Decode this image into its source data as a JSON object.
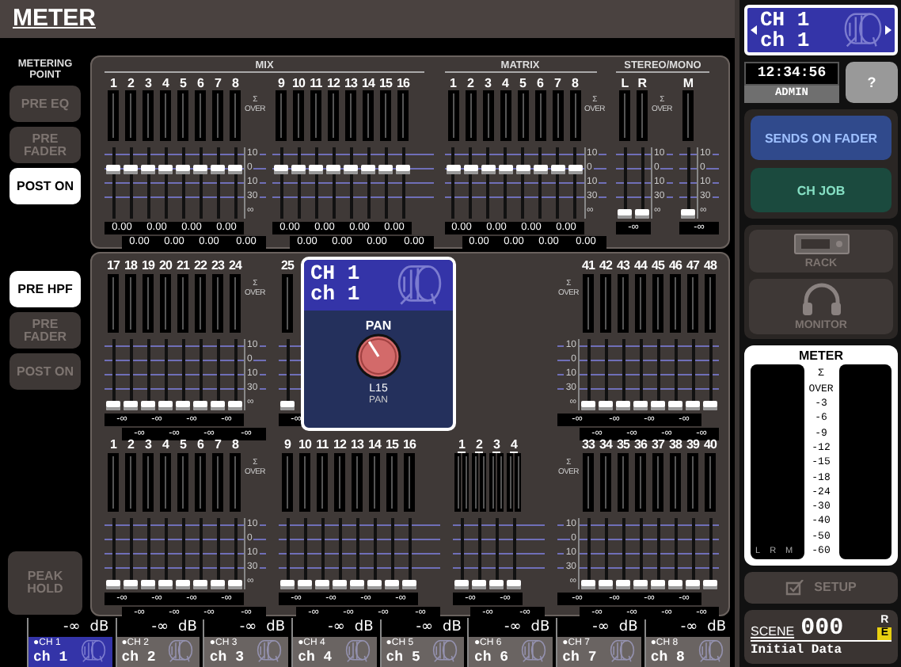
{
  "header": {
    "title": "METER"
  },
  "metering_point": {
    "label": "METERING POINT",
    "output_buttons": [
      {
        "label": "PRE EQ",
        "selected": false
      },
      {
        "label": "PRE FADER",
        "selected": false
      },
      {
        "label": "POST ON",
        "selected": true
      }
    ],
    "input_buttons": [
      {
        "label": "PRE HPF",
        "selected": true
      },
      {
        "label": "PRE FADER",
        "selected": false
      },
      {
        "label": "POST ON",
        "selected": false
      }
    ],
    "peak_hold": {
      "label": "PEAK HOLD",
      "on": false
    }
  },
  "output_panel": {
    "groups": [
      {
        "title": "MIX",
        "blocks": [
          {
            "kind": "mono8",
            "labels": [
              "1",
              "2",
              "3",
              "4",
              "5",
              "6",
              "7",
              "8"
            ],
            "level": 0.72,
            "values": [
              "0.00",
              "0.00",
              "0.00",
              "0.00",
              "0.00",
              "0.00",
              "0.00",
              "0.00"
            ],
            "over": "Σ OVER",
            "scale": [
              "10",
              "0",
              "10",
              "30",
              "∞"
            ],
            "scale_left": false
          },
          {
            "kind": "mono8",
            "labels": [
              "9",
              "10",
              "11",
              "12",
              "13",
              "14",
              "15",
              "16"
            ],
            "level": 0.72,
            "values": [
              "0.00",
              "0.00",
              "0.00",
              "0.00",
              "0.00",
              "0.00",
              "0.00",
              "0.00"
            ]
          }
        ]
      },
      {
        "title": "MATRIX",
        "blocks": [
          {
            "kind": "mono8",
            "labels": [
              "1",
              "2",
              "3",
              "4",
              "5",
              "6",
              "7",
              "8"
            ],
            "level": 0.72,
            "values": [
              "0.00",
              "0.00",
              "0.00",
              "0.00",
              "0.00",
              "0.00",
              "0.00",
              "0.00"
            ],
            "over": "Σ OVER",
            "scale": [
              "10",
              "0",
              "10",
              "30",
              "∞"
            ],
            "scale_left": false
          }
        ]
      },
      {
        "title": "STEREO/MONO",
        "blocks": [
          {
            "kind": "pair",
            "labels": [
              "L",
              "R"
            ],
            "level": 0,
            "values": [
              "-∞"
            ],
            "over": "Σ OVER",
            "scale": [
              "10",
              "0",
              "10",
              "30",
              "∞"
            ],
            "scale_left": false
          },
          {
            "kind": "single",
            "labels": [
              "M"
            ],
            "level": 0,
            "values": [
              "-∞"
            ],
            "scale": [
              "10",
              "0",
              "10",
              "30",
              "∞"
            ],
            "scale_left": false
          }
        ]
      }
    ]
  },
  "input_panel": {
    "columns": [
      {
        "top": {
          "kind": "mono8",
          "labels": [
            "17",
            "18",
            "19",
            "20",
            "21",
            "22",
            "23",
            "24"
          ],
          "level": 0,
          "values": [
            "-∞",
            "-∞",
            "-∞",
            "-∞",
            "-∞",
            "-∞",
            "-∞",
            "-∞"
          ],
          "over": "Σ OVER",
          "scale": [
            "10",
            "0",
            "10",
            "30",
            "∞"
          ],
          "scale_left": false
        },
        "bottom": {
          "kind": "mono8",
          "labels": [
            "1",
            "2",
            "3",
            "4",
            "5",
            "6",
            "7",
            "8"
          ],
          "level": 0,
          "values": [
            "-∞",
            "-∞",
            "-∞",
            "-∞",
            "-∞",
            "-∞",
            "-∞",
            "-∞"
          ],
          "over": "Σ OVER",
          "scale": [
            "10",
            "0",
            "10",
            "30",
            "∞"
          ],
          "scale_left": false
        }
      },
      {
        "top": {
          "kind": "mono8",
          "labels": [
            "25"
          ],
          "level": 0,
          "values": [
            "-∞"
          ]
        },
        "bottom": {
          "kind": "mono8",
          "labels": [
            "9",
            "10",
            "11",
            "12",
            "13",
            "14",
            "15",
            "16"
          ],
          "level": 0,
          "values": [
            "-∞",
            "-∞",
            "-∞",
            "-∞",
            "-∞",
            "-∞",
            "-∞",
            "-∞"
          ]
        }
      },
      {
        "bottom": {
          "kind": "quad",
          "labels": [
            "1",
            "2",
            "3",
            "4"
          ],
          "level": 0,
          "values": [
            "-∞",
            "-∞",
            "-∞",
            "-∞"
          ]
        }
      },
      {
        "top": {
          "kind": "mono8",
          "labels": [
            "41",
            "42",
            "43",
            "44",
            "45",
            "46",
            "47",
            "48"
          ],
          "level": 0,
          "values": [
            "-∞",
            "-∞",
            "-∞",
            "-∞",
            "-∞",
            "-∞",
            "-∞",
            "-∞"
          ],
          "over": "Σ OVER",
          "scale": [
            "10",
            "0",
            "10",
            "30",
            "∞"
          ],
          "scale_left": true
        },
        "bottom": {
          "kind": "mono8",
          "labels": [
            "33",
            "34",
            "35",
            "36",
            "37",
            "38",
            "39",
            "40"
          ],
          "level": 0,
          "values": [
            "-∞",
            "-∞",
            "-∞",
            "-∞",
            "-∞",
            "-∞",
            "-∞",
            "-∞"
          ],
          "over": "Σ OVER",
          "scale": [
            "10",
            "0",
            "10",
            "30",
            "∞"
          ],
          "scale_left": true
        }
      }
    ],
    "popup": {
      "channel": "CH 1",
      "name": "ch 1",
      "parameter": "PAN",
      "level": 0.38,
      "value": "L15",
      "value_label": "PAN"
    }
  },
  "channel_strip": [
    {
      "reading": "-∞",
      "unit": "dB",
      "number": "●CH 1",
      "name": "ch 1",
      "selected": true
    },
    {
      "reading": "-∞",
      "unit": "dB",
      "number": "●CH 2",
      "name": "ch 2",
      "selected": false
    },
    {
      "reading": "-∞",
      "unit": "dB",
      "number": "●CH 3",
      "name": "ch 3",
      "selected": false
    },
    {
      "reading": "-∞",
      "unit": "dB",
      "number": "●CH 4",
      "name": "ch 4",
      "selected": false
    },
    {
      "reading": "-∞",
      "unit": "dB",
      "number": "●CH 5",
      "name": "ch 5",
      "selected": false
    },
    {
      "reading": "-∞",
      "unit": "dB",
      "number": "●CH 6",
      "name": "ch 6",
      "selected": false
    },
    {
      "reading": "-∞",
      "unit": "dB",
      "number": "●CH 7",
      "name": "ch 7",
      "selected": false
    },
    {
      "reading": "-∞",
      "unit": "dB",
      "number": "●CH 8",
      "name": "ch 8",
      "selected": false
    }
  ],
  "sidebar": {
    "channel": {
      "number": "CH 1",
      "name": "ch 1"
    },
    "clock": "12:34:56",
    "user": "ADMIN",
    "help": "?",
    "buttons": [
      {
        "label": "SENDS ON FADER",
        "kind": "sends"
      },
      {
        "label": "CH JOB",
        "kind": "job"
      }
    ],
    "tools": [
      {
        "label": "RACK",
        "kind": "rack",
        "disabled": true
      },
      {
        "label": "MONITOR",
        "kind": "monitor",
        "disabled": true
      }
    ],
    "meter": {
      "title": "METER",
      "scale": [
        "Σ",
        "OVER",
        "-3",
        "-6",
        "-9",
        "-12",
        "-15",
        "-18",
        "-24",
        "-30",
        "-40",
        "-50",
        "-60"
      ],
      "channels": [
        "L",
        "R",
        "M"
      ]
    },
    "setup": {
      "label": "SETUP",
      "disabled": true
    },
    "scene": {
      "label": "SCENE",
      "number": "000",
      "flag": "R",
      "edit": "E",
      "title": "Initial Data"
    }
  }
}
